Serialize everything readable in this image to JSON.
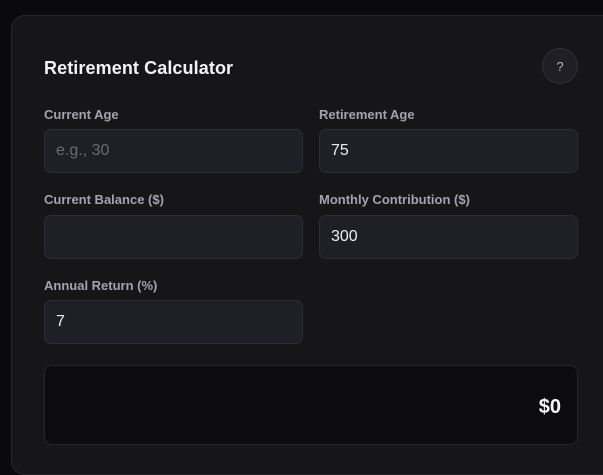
{
  "calculator": {
    "title": "Retirement Calculator",
    "help_label": "?",
    "fields": {
      "current_age": {
        "label": "Current Age",
        "value": "",
        "placeholder": "e.g., 30"
      },
      "retirement_age": {
        "label": "Retirement Age",
        "value": "75",
        "placeholder": ""
      },
      "current_balance": {
        "label": "Current Balance ($)",
        "value": "",
        "placeholder": ""
      },
      "monthly_contribution": {
        "label": "Monthly Contribution ($)",
        "value": "300",
        "placeholder": ""
      },
      "annual_return": {
        "label": "Annual Return (%)",
        "value": "7",
        "placeholder": ""
      }
    },
    "result": {
      "value": "$0"
    }
  },
  "colors": {
    "page_background": "#0a0a0c",
    "card_background": "#161619",
    "input_background": "#1f1f26",
    "label_text": "#a3a3ad",
    "value_text": "#ececf0"
  }
}
